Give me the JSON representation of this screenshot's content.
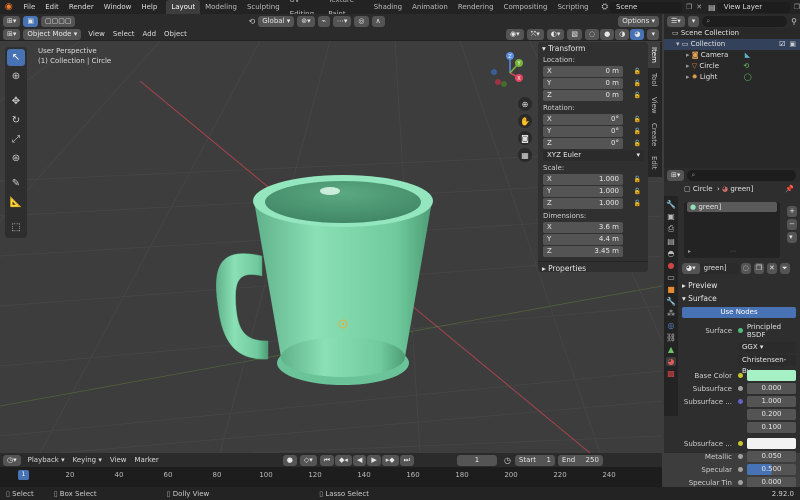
{
  "menu": {
    "items": [
      "File",
      "Edit",
      "Render",
      "Window",
      "Help"
    ]
  },
  "workspaces": [
    "Layout",
    "Modeling",
    "Sculpting",
    "UV Editing",
    "Texture Paint",
    "Shading",
    "Animation",
    "Rendering",
    "Compositing",
    "Scripting"
  ],
  "scene": {
    "label": "Scene"
  },
  "view_layer": {
    "label": "View Layer"
  },
  "header": {
    "mode": "Object Mode",
    "view": "View",
    "select": "Select",
    "add": "Add",
    "object": "Object",
    "orientation": "Global",
    "options": "Options"
  },
  "viewport": {
    "perspective": "User Perspective",
    "collection_info": "(1) Collection | Circle"
  },
  "npanel": {
    "tabs": [
      "Item",
      "Tool",
      "View",
      "Create",
      "Edit"
    ],
    "transform_title": "Transform",
    "location_label": "Location:",
    "location": [
      {
        "axis": "X",
        "value": "0 m"
      },
      {
        "axis": "Y",
        "value": "0 m"
      },
      {
        "axis": "Z",
        "value": "0 m"
      }
    ],
    "rotation_label": "Rotation:",
    "rotation": [
      {
        "axis": "X",
        "value": "0°"
      },
      {
        "axis": "Y",
        "value": "0°"
      },
      {
        "axis": "Z",
        "value": "0°"
      }
    ],
    "rotation_mode": "XYZ Euler",
    "scale_label": "Scale:",
    "scale": [
      {
        "axis": "X",
        "value": "1.000"
      },
      {
        "axis": "Y",
        "value": "1.000"
      },
      {
        "axis": "Z",
        "value": "1.000"
      }
    ],
    "dimensions_label": "Dimensions:",
    "dimensions": [
      {
        "axis": "X",
        "value": "3.6 m"
      },
      {
        "axis": "Y",
        "value": "4.4 m"
      },
      {
        "axis": "Z",
        "value": "3.45 m"
      }
    ],
    "properties_title": "Properties"
  },
  "outliner": {
    "root": "Scene Collection",
    "collection": "Collection",
    "items": [
      "Camera",
      "Circle",
      "Light"
    ]
  },
  "properties": {
    "breadcrumb_object": "Circle",
    "breadcrumb_material": "green]",
    "slot": "green]",
    "material_name": "green]",
    "preview": "Preview",
    "surface_title": "Surface",
    "use_nodes": "Use Nodes",
    "surface_label": "Surface",
    "surface_value": "Principled BSDF",
    "distribution": "GGX",
    "subsurface_method": "Christensen-Bu...",
    "base_color_label": "Base Color",
    "base_color": "#a6f0c6",
    "subsurface_label": "Subsurface",
    "subsurface_value": "0.000",
    "subsurface_radius_label": "Subsurface ...",
    "subsurface_radius": [
      "1.000",
      "0.200",
      "0.100"
    ],
    "subsurface_color_label": "Subsurface ...",
    "metallic_label": "Metallic",
    "metallic_value": "0.050",
    "specular_label": "Specular",
    "specular_value": "0.500",
    "specular_tint_label": "Specular Tin",
    "specular_tint_value": "0.000"
  },
  "timeline": {
    "playback": "Playback",
    "keying": "Keying",
    "view": "View",
    "marker": "Marker",
    "current_frame": "1",
    "start_label": "Start",
    "start": "1",
    "end_label": "End",
    "end": "250",
    "ticks": [
      "1",
      "20",
      "40",
      "60",
      "80",
      "100",
      "120",
      "140",
      "160",
      "180",
      "200",
      "220",
      "240"
    ]
  },
  "status": {
    "select": "Select",
    "box_select": "Box Select",
    "dolly_view": "Dolly View",
    "lasso_select": "Lasso Select",
    "version": "2.92.0"
  },
  "colors": {
    "accent": "#4772b3",
    "mug": "#7fd4a8",
    "bg": "#3d3d3d"
  }
}
